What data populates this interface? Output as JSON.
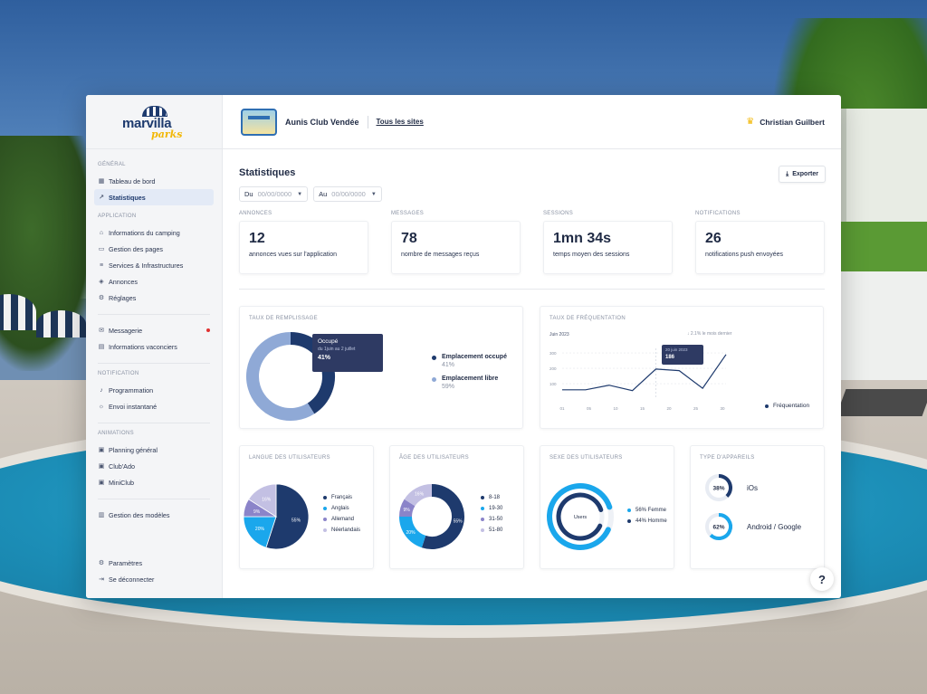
{
  "brand": {
    "name": "marvilla",
    "sub": "parks"
  },
  "header": {
    "site_name": "Aunis Club Vendée",
    "all_sites": "Tous les sites",
    "user_name": "Christian Guilbert"
  },
  "sidebar": {
    "section_general": "GÉNÉRAL",
    "dashboard": "Tableau de bord",
    "statistics": "Statistiques",
    "section_application": "APPLICATION",
    "camping_info": "Informations du camping",
    "pages": "Gestion des pages",
    "services": "Services & Infrastructures",
    "ads": "Annonces",
    "settings_app": "Réglages",
    "messaging": "Messagerie",
    "vacationers": "Informations vaconciers",
    "section_notification": "NOTIFICATION",
    "scheduling": "Programmation",
    "instant": "Envoi instantané",
    "section_animations": "ANIMATIONS",
    "planning": "Planning général",
    "club_ado": "Club'Ado",
    "miniclub": "MiniClub",
    "templates": "Gestion des modèles",
    "parameters": "Paramètres",
    "logout": "Se déconnecter"
  },
  "page": {
    "title": "Statistiques",
    "export_label": "Exporter",
    "from_label": "Du",
    "from_value": "00/00/0000",
    "to_label": "Au",
    "to_value": "00/00/0000"
  },
  "kpis": [
    {
      "label": "ANNONCES",
      "value": "12",
      "desc": "annonces vues sur l'application"
    },
    {
      "label": "MESSAGES",
      "value": "78",
      "desc": "nombre de messages reçus"
    },
    {
      "label": "SESSIONS",
      "value": "1mn 34s",
      "desc": "temps moyen des sessions"
    },
    {
      "label": "NOTIFICATIONS",
      "value": "26",
      "desc": "notifications push envoyées"
    }
  ],
  "colors": {
    "navy": "#1e3a6d",
    "light_blue": "#8fa9d6",
    "cyan": "#1aa7ec",
    "purple": "#8b84c9",
    "lavender": "#c3c0e3",
    "red": "#e03131"
  },
  "occupancy": {
    "title": "TAUX DE REMPLISSAGE",
    "tooltip_title": "Occupé",
    "tooltip_sub": "du 1juin au 2 juillet",
    "tooltip_value": "41%",
    "items": [
      {
        "label": "Emplacement occupé",
        "value": "41%",
        "pct": 41,
        "color": "#1e3a6d"
      },
      {
        "label": "Emplacement libre",
        "value": "59%",
        "pct": 59,
        "color": "#8fa9d6"
      }
    ]
  },
  "attendance": {
    "title": "TAUX DE FRÉQUENTATION",
    "period": "Juin 2023",
    "trend": "↓ 2.1% le mois dernier",
    "tooltip_date": "20 juin 2023",
    "tooltip_value": "186",
    "legend": "Fréquentation",
    "y_ticks": [
      "300",
      "200",
      "100"
    ],
    "x_ticks": [
      "01",
      "05",
      "10",
      "15",
      "20",
      "25",
      "30"
    ],
    "values": [
      60,
      60,
      90,
      55,
      195,
      185,
      70,
      290
    ]
  },
  "language": {
    "title": "LANGUE DES UTILISATEURS",
    "items": [
      {
        "label": "Français",
        "pct": 55,
        "text": "55%",
        "color": "#1e3a6d"
      },
      {
        "label": "Anglais",
        "pct": 20,
        "text": "20%",
        "color": "#1aa7ec"
      },
      {
        "label": "Allemand",
        "pct": 9,
        "text": "9%",
        "color": "#8b84c9"
      },
      {
        "label": "Néerlandais",
        "pct": 16,
        "text": "16%",
        "color": "#c3c0e3"
      }
    ]
  },
  "age": {
    "title": "ÂGE DES UTILISATEURS",
    "items": [
      {
        "label": "8-18",
        "pct": 55,
        "text": "55%",
        "color": "#1e3a6d"
      },
      {
        "label": "19-30",
        "pct": 20,
        "text": "20%",
        "color": "#1aa7ec"
      },
      {
        "label": "31-50",
        "pct": 9,
        "text": "9%",
        "color": "#8b84c9"
      },
      {
        "label": "51-80",
        "pct": 16,
        "text": "16%",
        "color": "#c3c0e3"
      }
    ]
  },
  "gender": {
    "title": "SEXE DES UTILISATEURS",
    "center": "Users",
    "items": [
      {
        "label": "56% Femme",
        "pct": 56,
        "color": "#1aa7ec"
      },
      {
        "label": "44% Homme",
        "pct": 44,
        "color": "#1e3a6d"
      }
    ]
  },
  "devices": {
    "title": "TYPE D'APPAREILS",
    "items": [
      {
        "label": "iOs",
        "pct": 38,
        "text": "38%",
        "color": "#1e3a6d"
      },
      {
        "label": "Android / Google",
        "pct": 62,
        "text": "62%",
        "color": "#1aa7ec"
      }
    ]
  },
  "help": {
    "label": "?"
  }
}
